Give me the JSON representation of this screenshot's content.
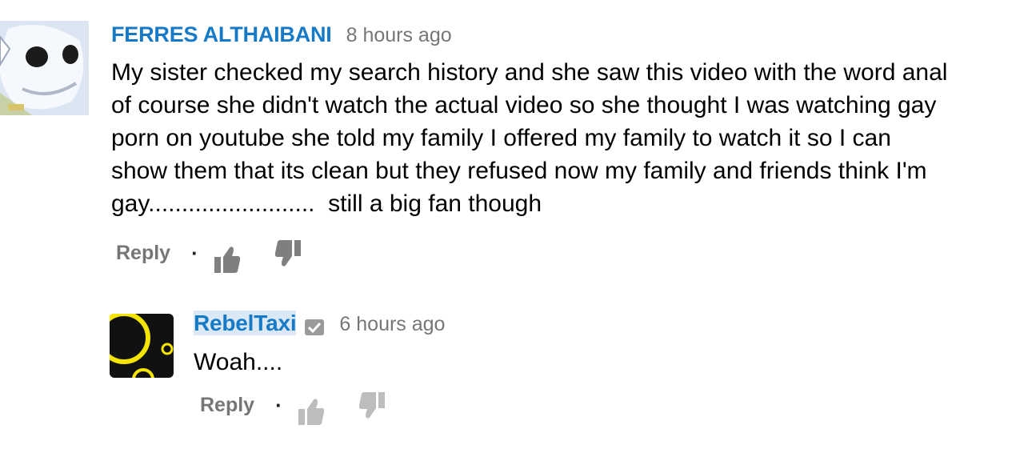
{
  "comment": {
    "author": "FERRES ALTHAIBANI",
    "time": "8 hours ago",
    "text_lines": [
      "My sister checked my search history and she saw this video with the word anal",
      "of course she didn't watch the actual video so she thought I was watching gay",
      "porn on youtube she told my family I offered my family to watch it so I can",
      "show them that its clean but they refused now my family and friends think I'm",
      "gay.........................  still a big fan though"
    ],
    "reply_label": "Reply",
    "separator": "·",
    "avatar_icon": "skeleton-avatar-icon"
  },
  "reply": {
    "author": "RebelTaxi",
    "time": "6 hours ago",
    "text": "Woah....",
    "reply_label": "Reply",
    "separator": "·",
    "verified_icon": "verified-check-icon",
    "avatar_icon": "yellow-circles-avatar-icon"
  },
  "colors": {
    "author_link": "#167ac6",
    "meta_gray": "#767676",
    "thumb_gray": "#7f7f7f"
  }
}
